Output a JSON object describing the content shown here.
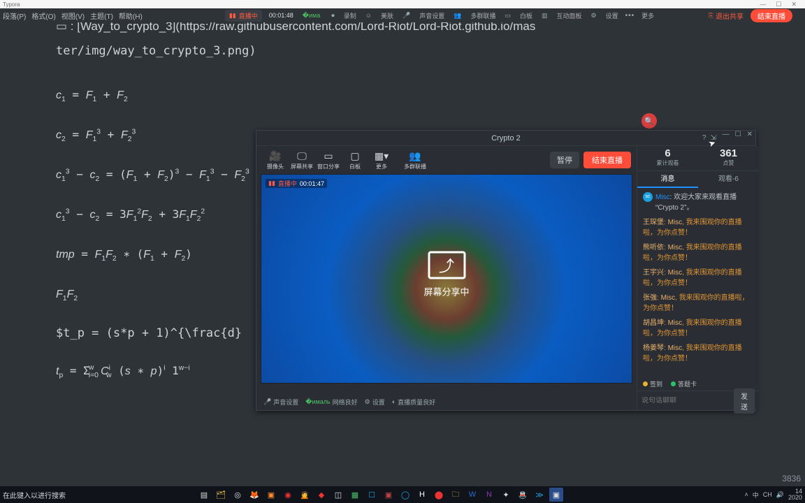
{
  "app": {
    "name": "Typora"
  },
  "menubar": {
    "items": [
      "段落(P)",
      "格式(O)",
      "视图(V)",
      "主题(T)",
      "帮助(H)"
    ],
    "live_label": "直播中",
    "timer": "00:01:48",
    "center_labels": [
      "录制",
      "美肤",
      "声音设置",
      "多群联播",
      "白板",
      "互动面板",
      "设置",
      "更多"
    ],
    "exit_share": "退出共享",
    "end_live": "结束直播"
  },
  "editor": {
    "path_line": ": [Way_to_crypto_3](https://raw.githubusercontent.com/Lord-Riot/Lord-Riot.github.io/mas",
    "path_line2": "ter/img/way_to_crypto_3.png)",
    "eq1": "c₁ = F₁ + F₂",
    "eq2": "c₂ = F₁³ + F₂³",
    "eq3": "c₁³ − c₂ = (F₁ + F₂)³ − F₁³ − F₂³",
    "eq4": "c₁³ − c₂ = 3F₁²F₂ + 3F₁F₂²",
    "eq5": "tmp = F₁F₂ ∗ (F₁ + F₂)",
    "eq6": "F₁F₂",
    "eq7_raw": "$t_p = (s*p + 1)^{\\frac{d}",
    "eq8": "tₚ = Σᵢ₌₀ʷ Cʷᵢ (s ∗ p)ⁱ 1ʷ⁻ⁱ",
    "word_count": "3836"
  },
  "stream": {
    "title": "Crypto 2",
    "toolbar": {
      "camera": "摄像头",
      "screen_share": "屏幕共享",
      "window_share": "窗口分享",
      "whiteboard": "白板",
      "more": "更多",
      "multi": "多群联播",
      "pause": "暂停",
      "end": "结束直播"
    },
    "preview": {
      "live_label": "直播中",
      "timer": "00:01:47",
      "caption": "屏幕分享中"
    },
    "footer": {
      "audio": "声音设置",
      "network": "网络良好",
      "settings": "设置",
      "quality": "直播质量良好"
    },
    "stats": {
      "viewers_num": "6",
      "viewers_label": "累计观看",
      "likes_num": "361",
      "likes_label": "点赞"
    },
    "tabs": {
      "chat": "消息",
      "viewers": "观看-6"
    },
    "chat": {
      "system_tag": "Misc",
      "system_text": "欢迎大家来观看直播 “Crypto 2”。",
      "messages": [
        {
          "name": "王琛堡",
          "tag": "Misc",
          "body": "我来围观你的直播啦，为你点赞！"
        },
        {
          "name": "熊听依",
          "tag": "Misc",
          "body": "我来围观你的直播啦，为你点赞！"
        },
        {
          "name": "王宇兴",
          "tag": "Misc",
          "body": "我来围观你的直播啦，为你点赞！"
        },
        {
          "name": "张強",
          "tag": "Misc",
          "body": "我来围观你的直播啦，为你点赞！"
        },
        {
          "name": "胡昌坤",
          "tag": "Misc",
          "body": "我来围观你的直播啦，为你点赞！"
        },
        {
          "name": "杨姜琴",
          "tag": "Misc",
          "body": "我来围观你的直播啦，为你点赞！"
        }
      ]
    },
    "badges": {
      "sign": "签到",
      "answer": "答题卡"
    },
    "input": {
      "placeholder": "说句话聊聊",
      "send": "发送"
    }
  },
  "taskbar": {
    "search_placeholder": "在此键入以进行搜索",
    "tray": {
      "ime": "中",
      "lang_icon": "CH",
      "time_top": "14",
      "time_bottom": "2020"
    }
  },
  "colors": {
    "accent_red": "#ff4d3a",
    "bg": "#2e3338",
    "panel": "#2a2e34"
  }
}
